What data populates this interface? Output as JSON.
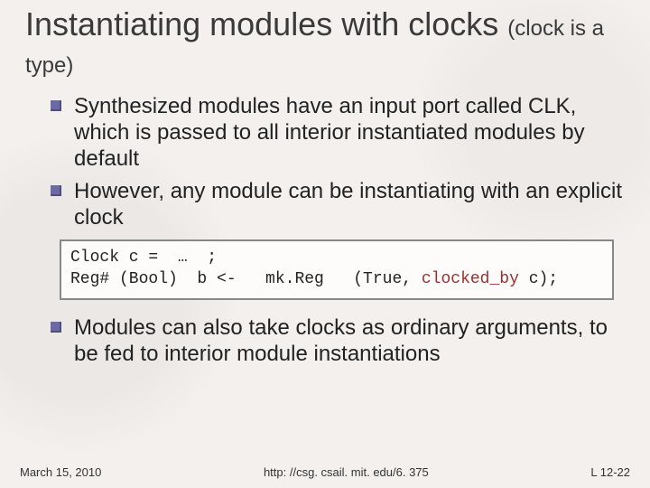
{
  "title_main": "Instantiating modules with clocks",
  "title_sub": "(clock is a type)",
  "bullets": {
    "b1": "Synthesized modules have an input port called CLK, which is passed to all interior instantiated modules by default",
    "b2": "However, any module can be instantiating with an explicit clock",
    "b3": "Modules can also take clocks as ordinary arguments, to be fed to interior module instantiations"
  },
  "code": {
    "line1_a": "Clock c =  …  ;",
    "line2_a": "Reg# (Bool)  b <-   mk.Reg   (True, ",
    "line2_kw": "clocked_by",
    "line2_b": " c);"
  },
  "footer": {
    "left": "March 15, 2010",
    "center": "http: //csg. csail. mit. edu/6. 375",
    "right": "L 12-22"
  }
}
